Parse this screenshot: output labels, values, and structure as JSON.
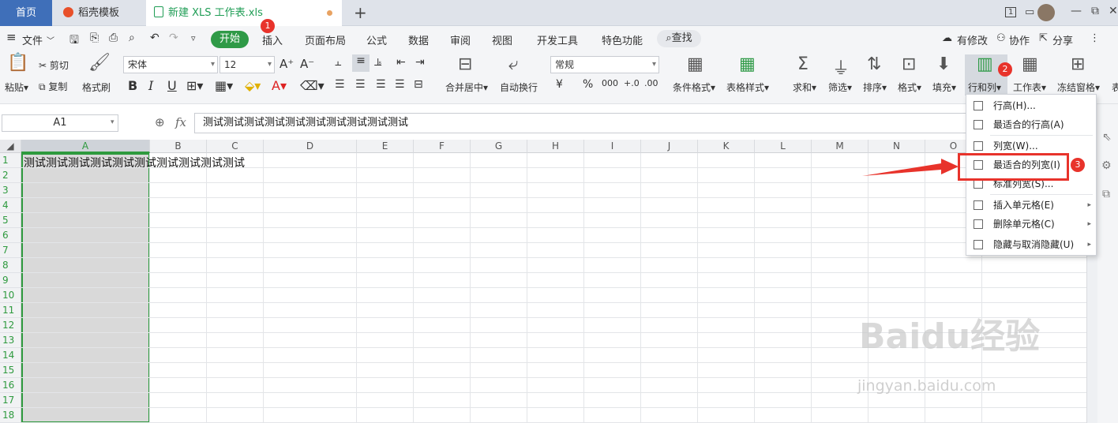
{
  "tabs": {
    "home": "首页",
    "template": "稻壳模板",
    "file": "新建 XLS 工作表.xls",
    "add": "+"
  },
  "window": {
    "page_indicator": "1",
    "minimize": "—",
    "restore": "⧉",
    "close": "✕"
  },
  "menu": {
    "hamburger": "≡",
    "file": "文件",
    "start": "开始",
    "insert": "插入",
    "page_layout": "页面布局",
    "formula": "公式",
    "data": "数据",
    "review": "审阅",
    "view": "视图",
    "dev_tools": "开发工具",
    "special": "特色功能",
    "search": "查找",
    "modified": "有修改",
    "collab": "协作",
    "share": "分享"
  },
  "ribbon": {
    "paste": "粘贴",
    "cut": "剪切",
    "copy": "复制",
    "format_painter": "格式刷",
    "font_name": "宋体",
    "font_size": "12",
    "bold": "B",
    "italic": "I",
    "underline": "U",
    "merge": "合并居中",
    "wrap": "自动换行",
    "number_format": "常规",
    "currency": "¥",
    "percent": "%",
    "thousands": "000",
    "cond_format": "条件格式",
    "table_style": "表格样式",
    "sum": "求和",
    "filter": "筛选",
    "sort": "排序",
    "format": "格式",
    "fill": "填充",
    "row_col": "行和列",
    "worksheet": "工作表",
    "freeze": "冻结窗格",
    "table_tools": "表"
  },
  "formula_bar": {
    "name_box": "A1",
    "fx": "fx",
    "value": "测试测试测试测试测试测试测试测试测试测试"
  },
  "grid": {
    "columns": [
      "A",
      "B",
      "C",
      "D",
      "E",
      "F",
      "G",
      "H",
      "I",
      "J",
      "K",
      "L",
      "M",
      "N",
      "O"
    ],
    "rows": [
      "1",
      "2",
      "3",
      "4",
      "5",
      "6",
      "7",
      "8",
      "9",
      "10",
      "11",
      "12",
      "13",
      "14",
      "15",
      "16",
      "17",
      "18"
    ],
    "cell_a1": "测试测试测试测试测试测试测试测试测试测试"
  },
  "dropdown": {
    "items": [
      {
        "label": "行高(H)...",
        "has_sub": false
      },
      {
        "label": "最适合的行高(A)",
        "has_sub": false
      },
      {
        "label": "列宽(W)...",
        "has_sub": false
      },
      {
        "label": "最适合的列宽(I)",
        "has_sub": false
      },
      {
        "label": "标准列宽(S)...",
        "has_sub": false
      },
      {
        "label": "插入单元格(E)",
        "has_sub": true
      },
      {
        "label": "删除单元格(C)",
        "has_sub": true
      },
      {
        "label": "隐藏与取消隐藏(U)",
        "has_sub": true
      }
    ]
  },
  "annotations": {
    "badge1": "1",
    "badge2": "2",
    "badge3": "3"
  },
  "watermark": {
    "brand": "Baidu经验",
    "url": "jingyan.baidu.com"
  },
  "colors": {
    "accent_green": "#2f9a47",
    "tab_blue": "#3f6fb9",
    "annotation_red": "#e8332b",
    "selection_border": "#2e9a3e"
  }
}
